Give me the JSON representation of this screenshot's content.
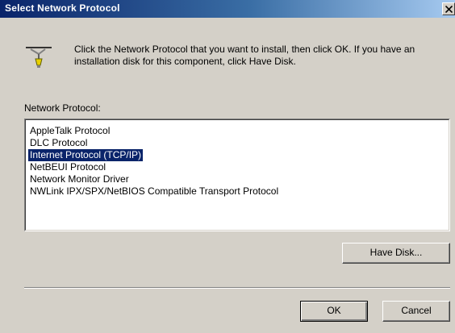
{
  "window": {
    "title": "Select Network Protocol",
    "close_icon": "close-x"
  },
  "header": {
    "icon": "network-protocol-icon",
    "instructions": "Click the Network Protocol that you want to install, then click OK. If you have an installation disk for this component, click Have Disk."
  },
  "list": {
    "label": "Network Protocol:",
    "items": [
      "AppleTalk Protocol",
      "DLC Protocol",
      "Internet Protocol (TCP/IP)",
      "NetBEUI Protocol",
      "Network Monitor Driver",
      "NWLink IPX/SPX/NetBIOS Compatible Transport Protocol"
    ],
    "selected_index": 2
  },
  "buttons": {
    "have_disk": "Have Disk...",
    "ok": "OK",
    "cancel": "Cancel"
  },
  "colors": {
    "face": "#d4d0c8",
    "title_active": "#0a246a",
    "selection": "#0a246a"
  }
}
